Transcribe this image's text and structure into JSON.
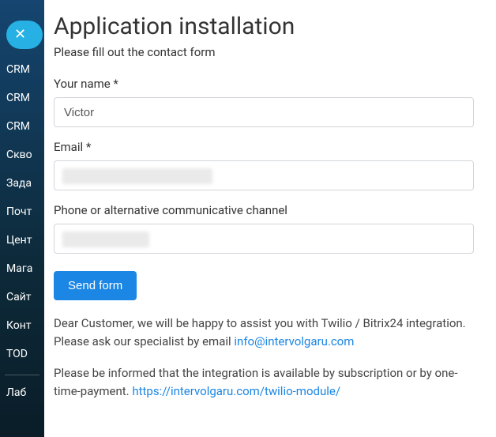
{
  "sidebar": {
    "items": [
      {
        "label": "CRM"
      },
      {
        "label": "CRM"
      },
      {
        "label": "CRM"
      },
      {
        "label": "Скво"
      },
      {
        "label": "Зада"
      },
      {
        "label": "Почт"
      },
      {
        "label": "Цент"
      },
      {
        "label": "Мага"
      },
      {
        "label": "Сайт"
      },
      {
        "label": "Конт"
      },
      {
        "label": "TOD"
      }
    ],
    "footerItem": {
      "label": "Лаб"
    }
  },
  "modal": {
    "title": "Application installation",
    "subtitle": "Please fill out the contact form",
    "fields": {
      "name": {
        "label": "Your name *",
        "value": "Victor"
      },
      "email": {
        "label": "Email *",
        "value": ""
      },
      "phone": {
        "label": "Phone or alternative communicative channel",
        "value": ""
      }
    },
    "submitLabel": "Send form",
    "infoPara1_pre": "Dear Customer, we will be happy to assist you with Twilio / Bitrix24 integration. Please ask our specialist by email ",
    "infoEmailLink": "info@intervolgaru.com",
    "infoPara2_pre": "Please be informed that the integration is available by subscription or by one-time-payment. ",
    "infoUrlLink": "https://intervolgaru.com/twilio-module/"
  }
}
